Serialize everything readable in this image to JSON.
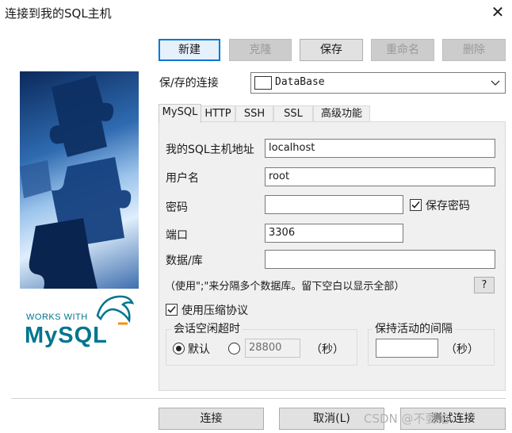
{
  "window": {
    "title": "连接到我的SQL主机",
    "close_glyph": "✕"
  },
  "toolbar": {
    "new_label": "新建",
    "clone_label": "克隆",
    "save_label": "保存",
    "rename_label": "重命名",
    "delete_label": "删除"
  },
  "connection": {
    "saved_label": "保/存的连接",
    "selected": "DataBase"
  },
  "tabs": [
    {
      "label": "MySQL",
      "active": true
    },
    {
      "label": "HTTP",
      "active": false
    },
    {
      "label": "SSH",
      "active": false
    },
    {
      "label": "SSL",
      "active": false
    },
    {
      "label": "高级功能",
      "active": false
    }
  ],
  "form": {
    "host_label": "我的SQL主机地址",
    "host_value": "localhost",
    "user_label": "用户名",
    "user_value": "root",
    "password_label": "密码",
    "password_value": "",
    "save_password_label": "保存密码",
    "save_password_checked": true,
    "port_label": "端口",
    "port_value": "3306",
    "database_label": "数据/库",
    "database_value": "",
    "hint": "（使用\";\"来分隔多个数据库。留下空白以显示全部）",
    "help_label": "?",
    "compress_label": "使用压缩协议",
    "compress_checked": true
  },
  "idle_timeout": {
    "legend": "会话空闲超时",
    "default_label": "默认",
    "custom_value": "28800",
    "unit": "（秒）"
  },
  "keepalive": {
    "legend": "保持活动的间隔",
    "value": "",
    "unit": "（秒）"
  },
  "footer": {
    "connect_label": "连接",
    "cancel_label": "取消(L)",
    "test_label": "测试连接"
  },
  "side_image": {
    "logo_text_top": "WORKS WITH",
    "logo_text_main": "MySQL"
  },
  "watermark": "CSDN @不要怕",
  "colors": {
    "accent": "#0078d7",
    "panel_bg": "#f0f0f0",
    "mysql_blue": "#00758f",
    "mysql_orange": "#f29111"
  }
}
